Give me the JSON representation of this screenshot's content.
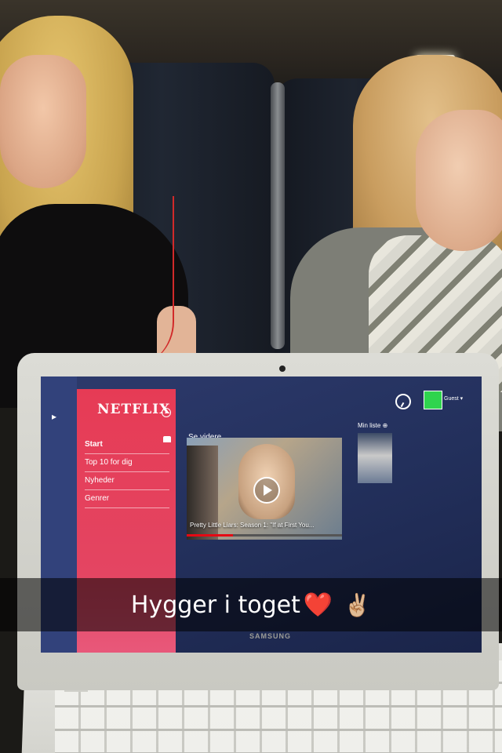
{
  "netflix": {
    "logo": "NETFLIX",
    "menu": [
      {
        "label": "Start",
        "active": true
      },
      {
        "label": "Top 10 for dig",
        "active": false
      },
      {
        "label": "Nyheder",
        "active": false
      },
      {
        "label": "Genrer",
        "active": false
      }
    ],
    "continue_watching_title": "Se videre",
    "now_playing": "Pretty Little Liars: Season 1: \"If at First You...",
    "progress": 0.3,
    "my_list_title": "Min liste ⊕",
    "user_name": "Guest ▾",
    "avatar_color": "#2fd44e",
    "accent_color": "#e63b55"
  },
  "laptop_brand": "SAMSUNG",
  "caption": {
    "text": "Hygger i toget",
    "heart": "❤️",
    "peace": "✌🏼"
  }
}
